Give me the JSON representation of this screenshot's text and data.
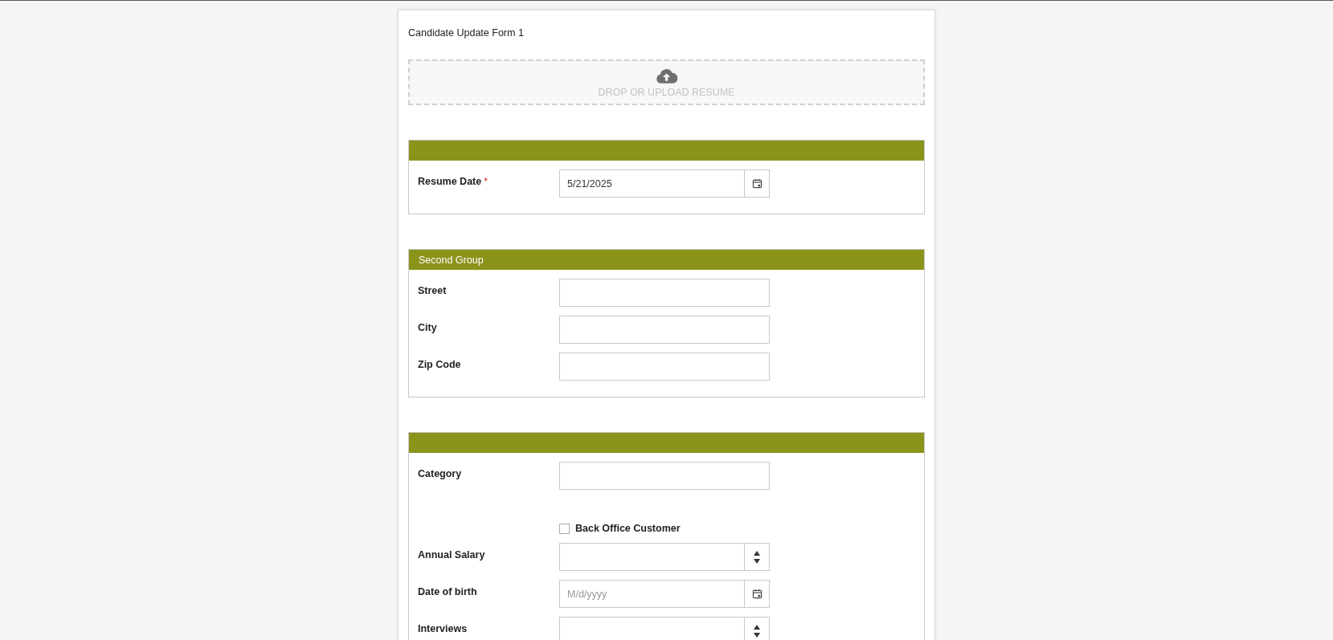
{
  "form": {
    "title": "Candidate Update Form 1",
    "upload": {
      "label": "DROP OR UPLOAD RESUME"
    },
    "groups": [
      {
        "fields": [
          {
            "kind": "date",
            "label": "Resume Date",
            "required_mark": "*",
            "value": "5/21/2025"
          }
        ]
      },
      {
        "title": "Second Group",
        "fields": [
          {
            "kind": "text",
            "label": "Street"
          },
          {
            "kind": "text",
            "label": "City"
          },
          {
            "kind": "text",
            "label": "Zip Code"
          }
        ]
      },
      {
        "fields": [
          {
            "kind": "text",
            "label": "Category"
          },
          {
            "kind": "checkbox",
            "label": "Back Office Customer",
            "checked": false
          },
          {
            "kind": "number",
            "label": "Annual Salary"
          },
          {
            "kind": "date",
            "label": "Date of birth",
            "placeholder": "M/d/yyyy"
          },
          {
            "kind": "number",
            "label": "Interviews"
          }
        ]
      }
    ]
  }
}
